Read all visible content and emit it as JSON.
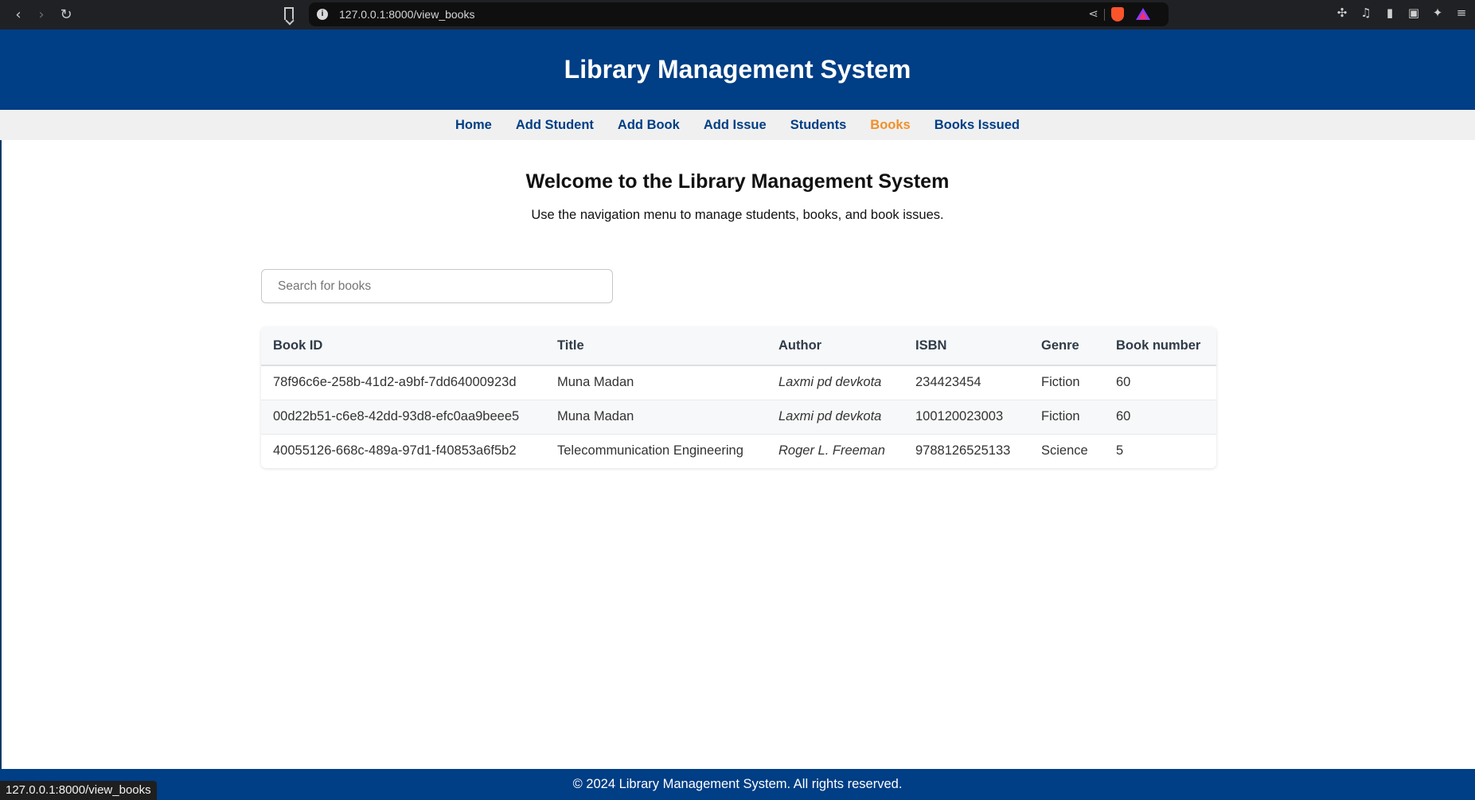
{
  "browser": {
    "url": "127.0.0.1:8000/view_books",
    "status_url": "127.0.0.1:8000/view_books"
  },
  "header": {
    "title": "Library Management System"
  },
  "nav": {
    "items": [
      {
        "label": "Home",
        "active": false
      },
      {
        "label": "Add Student",
        "active": false
      },
      {
        "label": "Add Book",
        "active": false
      },
      {
        "label": "Add Issue",
        "active": false
      },
      {
        "label": "Students",
        "active": false
      },
      {
        "label": "Books",
        "active": true
      },
      {
        "label": "Books Issued",
        "active": false
      }
    ]
  },
  "welcome": {
    "heading": "Welcome to the Library Management System",
    "subtext": "Use the navigation menu to manage students, books, and book issues."
  },
  "search": {
    "placeholder": "Search for books",
    "value": ""
  },
  "table": {
    "columns": [
      "Book ID",
      "Title",
      "Author",
      "ISBN",
      "Genre",
      "Book number"
    ],
    "rows": [
      [
        "78f96c6e-258b-41d2-a9bf-7dd64000923d",
        "Muna Madan",
        "Laxmi pd devkota",
        "234423454",
        "Fiction",
        "60"
      ],
      [
        "00d22b51-c6e8-42dd-93d8-efc0aa9beee5",
        "Muna Madan",
        "Laxmi pd devkota",
        "100120023003",
        "Fiction",
        "60"
      ],
      [
        "40055126-668c-489a-97d1-f40853a6f5b2",
        "Telecommunication Engineering",
        "Roger L. Freeman",
        "9788126525133",
        "Science",
        "5"
      ]
    ]
  },
  "footer": {
    "text": "© 2024 Library Management System. All rights reserved."
  },
  "colors": {
    "brand": "#003e85",
    "active_nav": "#f0902a"
  }
}
